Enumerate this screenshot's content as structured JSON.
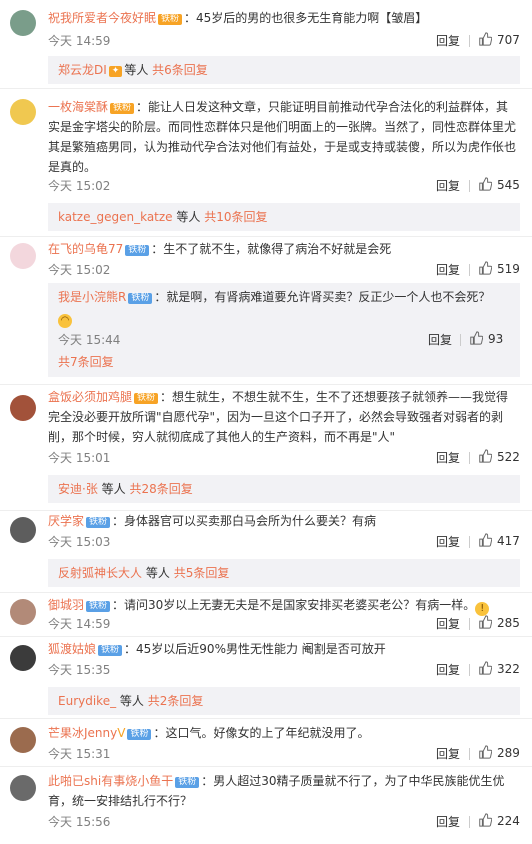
{
  "comments": [
    {
      "username": "祝我所爱者今夜好眠",
      "badge": "铁粉",
      "text": "：45岁后的男的也很多无生育能力啊【皱眉】",
      "time": "今天 14:59",
      "reply_label": "回复",
      "likes": "707",
      "avatar_color": "#7a9d8a",
      "sub": {
        "name": "郑云龙DI",
        "etc": "等人",
        "more": "共6条回复"
      }
    },
    {
      "username": "一枚海棠酥",
      "badge": "铁粉",
      "text": "：能让人日发这种文章，只能证明目前推动代孕合法化的利益群体，其实是金字塔尖的阶层。而同性恋群体只是他们明面上的一张牌。当然了，同性恋群体里尤其是繁殖癌男同，认为推动代孕合法对他们有益处，于是或支持或装傻，所以为虎作伥也是真的。",
      "time": "今天 15:02",
      "reply_label": "回复",
      "likes": "545",
      "avatar_color": "#f0c850",
      "sub": {
        "name": "katze_gegen_katze",
        "etc": "等人",
        "more": "共10条回复"
      }
    },
    {
      "username": "在飞的乌龟77",
      "badge": "铁粉",
      "text": "：生不了就不生，就像得了病治不好就是会死",
      "time": "今天 15:02",
      "reply_label": "回复",
      "likes": "519",
      "avatar_color": "#f3d7dd",
      "nested": {
        "username": "我是小浣熊R",
        "badge": "铁粉",
        "text": "：就是啊，有肾病难道要允许肾买卖？反正少一个人也不会死？",
        "time": "今天 15:44",
        "reply_label": "回复",
        "likes": "93",
        "more": "共7条回复"
      }
    },
    {
      "username": "盒饭必须加鸡腿",
      "badge": "铁粉",
      "text": "：想生就生，不想生就不生，生不了还想要孩子就领养——我觉得完全没必要开放所谓\"自愿代孕\"，因为一旦这个口子开了，必然会导致强者对弱者的剥削，那个时候，穷人就彻底成了其他人的生产资料，而不再是\"人\"",
      "time": "今天 15:01",
      "reply_label": "回复",
      "likes": "522",
      "avatar_color": "#a2523a",
      "sub": {
        "name": "安迪·张",
        "etc": "等人",
        "more": "共28条回复"
      }
    },
    {
      "username": "厌学家",
      "badge": "铁粉",
      "text": "：身体器官可以买卖那白马会所为什么要关？有病",
      "time": "今天 15:03",
      "reply_label": "回复",
      "likes": "417",
      "avatar_color": "#5d5d5d",
      "sub": {
        "name": "反射弧神长大人",
        "etc": "等人",
        "more": "共5条回复"
      }
    },
    {
      "username": "御城羽",
      "badge": "铁粉",
      "text": "：请问30岁以上无妻无夫是不是国家安排买老婆买老公？有病一样。",
      "time": "今天 14:59",
      "reply_label": "回复",
      "likes": "285",
      "avatar_color": "#b28a78"
    },
    {
      "username": "狐渡姑娘",
      "badge": "铁粉",
      "text": "：45岁以后近90%男性无性能力 阉割是否可放开",
      "time": "今天 15:35",
      "reply_label": "回复",
      "likes": "322",
      "avatar_color": "#3b3b3b",
      "sub": {
        "name": "Eurydike_",
        "etc": "等人",
        "more": "共2条回复"
      }
    },
    {
      "username": "芒果冰Jenny",
      "badge": "铁粉",
      "text": "：这口气。好像女的上了年纪就没用了。",
      "time": "今天 15:31",
      "reply_label": "回复",
      "likes": "289",
      "avatar_color": "#9b6b4e"
    },
    {
      "username": "此啪已shi有事烧小鱼干",
      "badge": "铁粉",
      "text": "：男人超过30精子质量就不行了，为了中华民族能优生优育，统一安排结扎行不行？",
      "time": "今天 15:56",
      "reply_label": "回复",
      "likes": "224",
      "avatar_color": "#6a6a6a"
    }
  ]
}
